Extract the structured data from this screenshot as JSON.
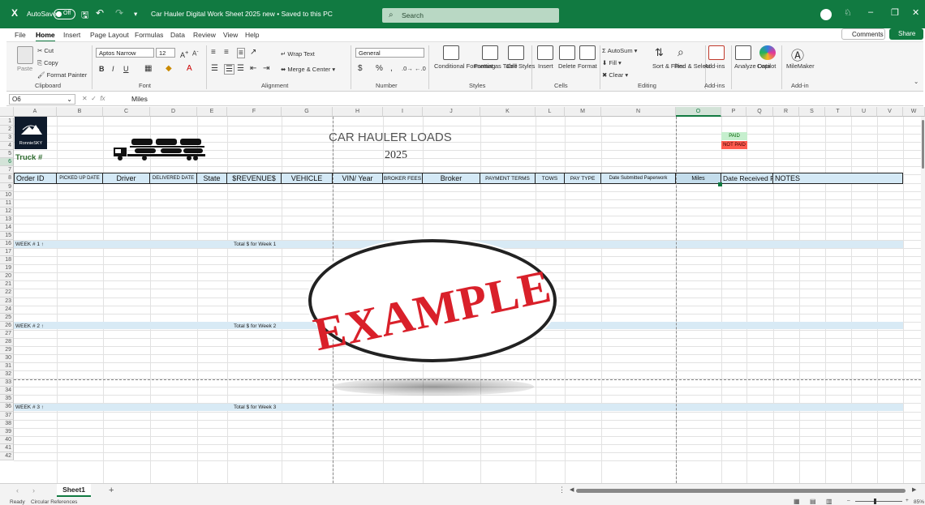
{
  "titlebar": {
    "autosave_label": "AutoSave",
    "autosave_state": "Off",
    "doc_title": "Car Hauler Digital Work Sheet 2025 new • Saved to this PC",
    "search_placeholder": "Search",
    "win_min": "–",
    "win_restore": "❐",
    "win_close": "✕"
  },
  "menu_tabs": [
    "File",
    "Home",
    "Insert",
    "Page Layout",
    "Formulas",
    "Data",
    "Review",
    "View",
    "Help"
  ],
  "active_tab": "Home",
  "comments_label": "Comments",
  "share_label": "Share",
  "ribbon": {
    "clipboard": {
      "paste": "Paste",
      "cut": "Cut",
      "copy": "Copy",
      "format_painter": "Format Painter",
      "label": "Clipboard"
    },
    "font": {
      "name": "Aptos Narrow",
      "size": "12",
      "label": "Font"
    },
    "alignment": {
      "wrap": "Wrap Text",
      "merge": "Merge & Center",
      "label": "Alignment"
    },
    "number": {
      "format": "General",
      "label": "Number"
    },
    "styles": {
      "conditional": "Conditional Formatting",
      "format_table": "Format as Table",
      "cell_styles": "Cell Styles",
      "label": "Styles"
    },
    "cells": {
      "insert": "Insert",
      "delete": "Delete",
      "format": "Format",
      "label": "Cells"
    },
    "editing": {
      "autosum": "AutoSum",
      "fill": "Fill",
      "clear": "Clear",
      "sort": "Sort & Filter",
      "find": "Find & Select",
      "label": "Editing"
    },
    "addins": {
      "addins": "Add-ins",
      "analyze": "Analyze Data",
      "copilot": "Copilot",
      "label": "Add-ins"
    },
    "milemaker": {
      "name": "MileMaker",
      "label": "Add-in"
    }
  },
  "formula": {
    "namebox": "O6",
    "fx": "fx",
    "value": "Miles"
  },
  "columns": [
    "A",
    "B",
    "C",
    "D",
    "E",
    "F",
    "G",
    "H",
    "I",
    "J",
    "K",
    "L",
    "M",
    "N",
    "O",
    "P",
    "Q",
    "R",
    "S",
    "T",
    "U",
    "V",
    "W"
  ],
  "rows": [
    "1",
    "2",
    "3",
    "4",
    "5",
    "6",
    "7",
    "8",
    "9",
    "10",
    "11",
    "12",
    "13",
    "14",
    "15",
    "16",
    "17",
    "18",
    "19",
    "20",
    "21",
    "22",
    "23",
    "24",
    "25",
    "26",
    "27",
    "28",
    "29",
    "30",
    "31",
    "32",
    "33",
    "34",
    "35",
    "36",
    "37",
    "38",
    "39",
    "40",
    "41",
    "42"
  ],
  "sheet": {
    "title": "CAR HAULER LOADS",
    "year": "2025",
    "truck_label": "Truck #",
    "logo_text": "RonnieSKY",
    "paid": "PAID",
    "not_paid": "NOT PAID",
    "headers": [
      "Order ID",
      "PICKED UP DATE",
      "Driver",
      "DELIVERED DATE",
      "State",
      "$REVENUE$",
      "VEHICLE",
      "VIN/ Year",
      "BROKER FEES",
      "Broker",
      "PAYMENT TERMS",
      "TOWS",
      "PAY TYPE",
      "Date Submitted Paperwork",
      "Miles",
      "Date Received Payment",
      "NOTES"
    ],
    "weeks": [
      {
        "label": "WEEK # 1",
        "total": "Total $ for Week 1"
      },
      {
        "label": "WEEK # 2",
        "total": "Total $ for Week 2"
      },
      {
        "label": "WEEK # 3",
        "total": "Total $ for Week 3"
      }
    ],
    "stamp": "EXAMPLE"
  },
  "sheet_tab": "Sheet1",
  "status": {
    "ready": "Ready",
    "circular": "Circular References",
    "zoom": "85%"
  }
}
